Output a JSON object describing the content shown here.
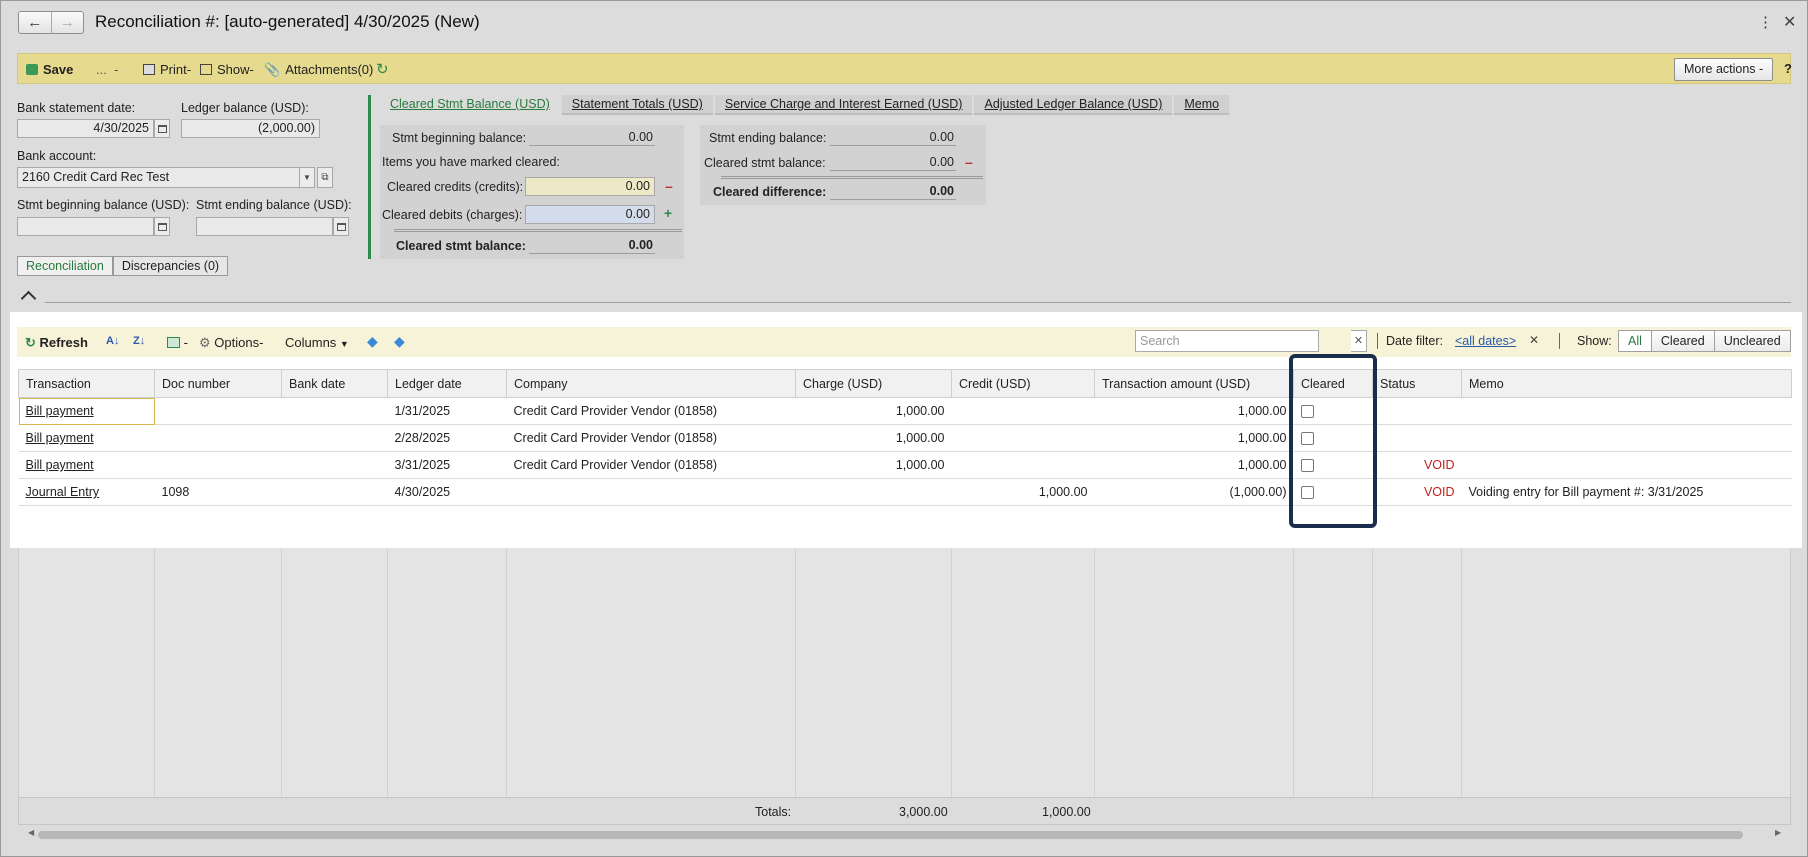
{
  "window": {
    "title": "Reconciliation #: [auto-generated] 4/30/2025 (New)"
  },
  "toolbar": {
    "save": "Save",
    "dots": "...",
    "print": "Print",
    "show": "Show",
    "attachments": "Attachments(0)",
    "more_actions": "More actions",
    "help": "?"
  },
  "form": {
    "bank_statement_date_label": "Bank statement date:",
    "bank_statement_date": "4/30/2025",
    "ledger_balance_label": "Ledger balance (USD):",
    "ledger_balance": "(2,000.00)",
    "bank_account_label": "Bank account:",
    "bank_account": "2160 Credit Card Rec Test",
    "stmt_beginning_label": "Stmt beginning balance (USD):",
    "stmt_ending_label": "Stmt ending balance (USD):"
  },
  "tabs": [
    "Cleared Stmt Balance (USD)",
    "Statement Totals (USD)",
    "Service Charge and Interest Earned (USD)",
    "Adjusted Ledger Balance (USD)",
    "Memo"
  ],
  "cleared_panel": {
    "stmt_beginning_label": "Stmt beginning balance:",
    "stmt_beginning": "0.00",
    "items_marked_label": "Items you have marked cleared:",
    "cleared_credits_label": "Cleared credits (credits):",
    "cleared_credits": "0.00",
    "cleared_debits_label": "Cleared debits (charges):",
    "cleared_debits": "0.00",
    "cleared_stmt_label": "Cleared stmt balance:",
    "cleared_stmt": "0.00"
  },
  "diff_panel": {
    "stmt_ending_label": "Stmt ending balance:",
    "stmt_ending": "0.00",
    "cleared_stmt_label": "Cleared stmt balance:",
    "cleared_stmt": "0.00",
    "cleared_diff_label": "Cleared difference:",
    "cleared_diff": "0.00"
  },
  "subtabs": [
    "Reconciliation",
    "Discrepancies (0)"
  ],
  "grid_toolbar": {
    "refresh": "Refresh",
    "options": "Options",
    "columns": "Columns",
    "search_placeholder": "Search",
    "date_filter_label": "Date filter:",
    "date_filter_value": "<all dates>",
    "show_label": "Show:",
    "show_options": [
      "All",
      "Cleared",
      "Uncleared"
    ]
  },
  "grid": {
    "columns": [
      "Transaction",
      "Doc number",
      "Bank date",
      "Ledger date",
      "Company",
      "Charge (USD)",
      "Credit (USD)",
      "Transaction amount (USD)",
      "Cleared",
      "Status",
      "Memo"
    ],
    "rows": [
      {
        "transaction": "Bill payment",
        "doc": "",
        "bank_date": "",
        "ledger_date": "1/31/2025",
        "company": "Credit Card Provider Vendor (01858)",
        "charge": "1,000.00",
        "credit": "",
        "amount": "1,000.00",
        "cleared": false,
        "status": "",
        "memo": ""
      },
      {
        "transaction": "Bill payment",
        "doc": "",
        "bank_date": "",
        "ledger_date": "2/28/2025",
        "company": "Credit Card Provider Vendor (01858)",
        "charge": "1,000.00",
        "credit": "",
        "amount": "1,000.00",
        "cleared": false,
        "status": "",
        "memo": ""
      },
      {
        "transaction": "Bill payment",
        "doc": "",
        "bank_date": "",
        "ledger_date": "3/31/2025",
        "company": "Credit Card Provider Vendor (01858)",
        "charge": "1,000.00",
        "credit": "",
        "amount": "1,000.00",
        "cleared": false,
        "status": "VOID",
        "memo": ""
      },
      {
        "transaction": "Journal Entry",
        "doc": "1098",
        "bank_date": "",
        "ledger_date": "4/30/2025",
        "company": "",
        "charge": "",
        "credit": "1,000.00",
        "amount": "(1,000.00)",
        "cleared": false,
        "status": "VOID",
        "memo": "Voiding entry for Bill payment #:  3/31/2025"
      }
    ],
    "totals_label": "Totals:",
    "total_charge": "3,000.00",
    "total_credit": "1,000.00"
  },
  "colors": {
    "toolbar_bg": "#e6da8e",
    "accent_green": "#2a7a3f",
    "void_red": "#c02020",
    "highlight": "#1b2d4c"
  }
}
